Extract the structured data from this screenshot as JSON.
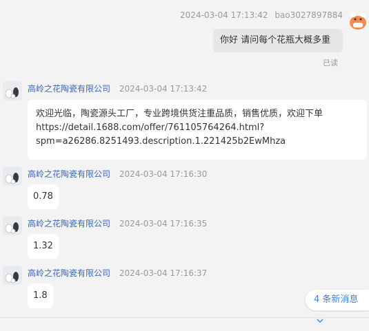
{
  "self_message": {
    "time": "2024-03-04 17:13:42",
    "user": "bao3027897884",
    "text": "你好 请问每个花瓶大概多重",
    "status": "已读"
  },
  "messages": [
    {
      "sender": "高岭之花陶瓷有限公司",
      "time": "2024-03-04 17:13:42",
      "lines": [
        "欢迎光临，陶瓷源头工厂，专业跨境供货注重品质，销售优质，欢迎下单",
        "https://detail.1688.com/offer/761105764264.html?",
        "spm=a26286.8251493.description.1.221425b2EwMhza"
      ]
    },
    {
      "sender": "高岭之花陶瓷有限公司",
      "time": "2024-03-04 17:16:30",
      "text": "0.78"
    },
    {
      "sender": "高岭之花陶瓷有限公司",
      "time": "2024-03-04 17:16:35",
      "text": "1.32"
    },
    {
      "sender": "高岭之花陶瓷有限公司",
      "time": "2024-03-04 17:16:37",
      "text": "1.8"
    }
  ],
  "new_messages": {
    "label": "4 条新消息"
  },
  "icons": {
    "self_avatar": "cow-avatar-icon",
    "seller_avatar": "vase-avatar-icon",
    "new_messages": "chevron-down-icon"
  },
  "colors": {
    "link_name": "#3b66b8",
    "accent": "#3f7fd9",
    "bubble_self": "#e6e6e6",
    "background": "#f3f3f3"
  }
}
